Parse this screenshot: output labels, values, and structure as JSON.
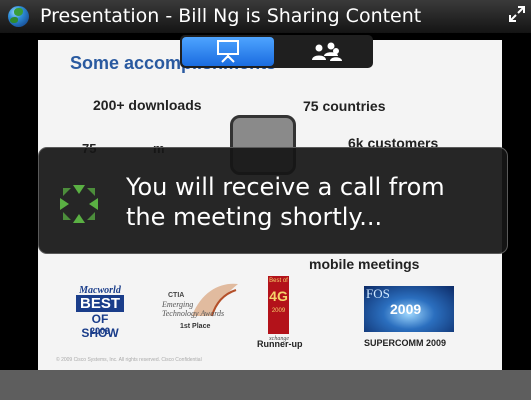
{
  "titlebar": {
    "title": "Presentation - Bill Ng is Sharing Content",
    "app_icon": "globe-icon",
    "expand_icon": "expand-icon"
  },
  "tabs": [
    {
      "icon": "presentation-icon",
      "active": true
    },
    {
      "icon": "participants-icon",
      "active": false
    }
  ],
  "slide": {
    "heading": "Some accomplishments",
    "stats": {
      "downloads": "200+ downloads",
      "countries": "75 countries",
      "customers": "6k customers",
      "partial_left": "75",
      "partial_mid": "m",
      "mobile": "mobile meetings"
    },
    "awards": {
      "macworld": {
        "line1": "Macworld",
        "line2": "BEST",
        "line3": "OF SHOW",
        "year": "2009"
      },
      "ctia": {
        "line1": "CTIA",
        "line2": "Emerging",
        "line3": "Technology Awards",
        "place": "1st Place"
      },
      "fourg": {
        "top": "Best of",
        "main": "4G",
        "year": "2009",
        "sub": "xchange",
        "caption": "Runner-up"
      },
      "fos": {
        "line1": "FOS",
        "year": "2009",
        "caption": "SUPERCOMM 2009"
      }
    },
    "footer": "© 2009 Cisco Systems, Inc. All rights reserved.   Cisco Confidential"
  },
  "toast": {
    "line1": "You will receive a call from",
    "line2": "the meeting shortly...",
    "icon": "loading-spinner-icon",
    "spinner_color": "#5ab043"
  },
  "colors": {
    "tab_active": "#2f86f0",
    "heading_blue": "#2a5aa0",
    "bottombar": "#5e5e5e"
  }
}
